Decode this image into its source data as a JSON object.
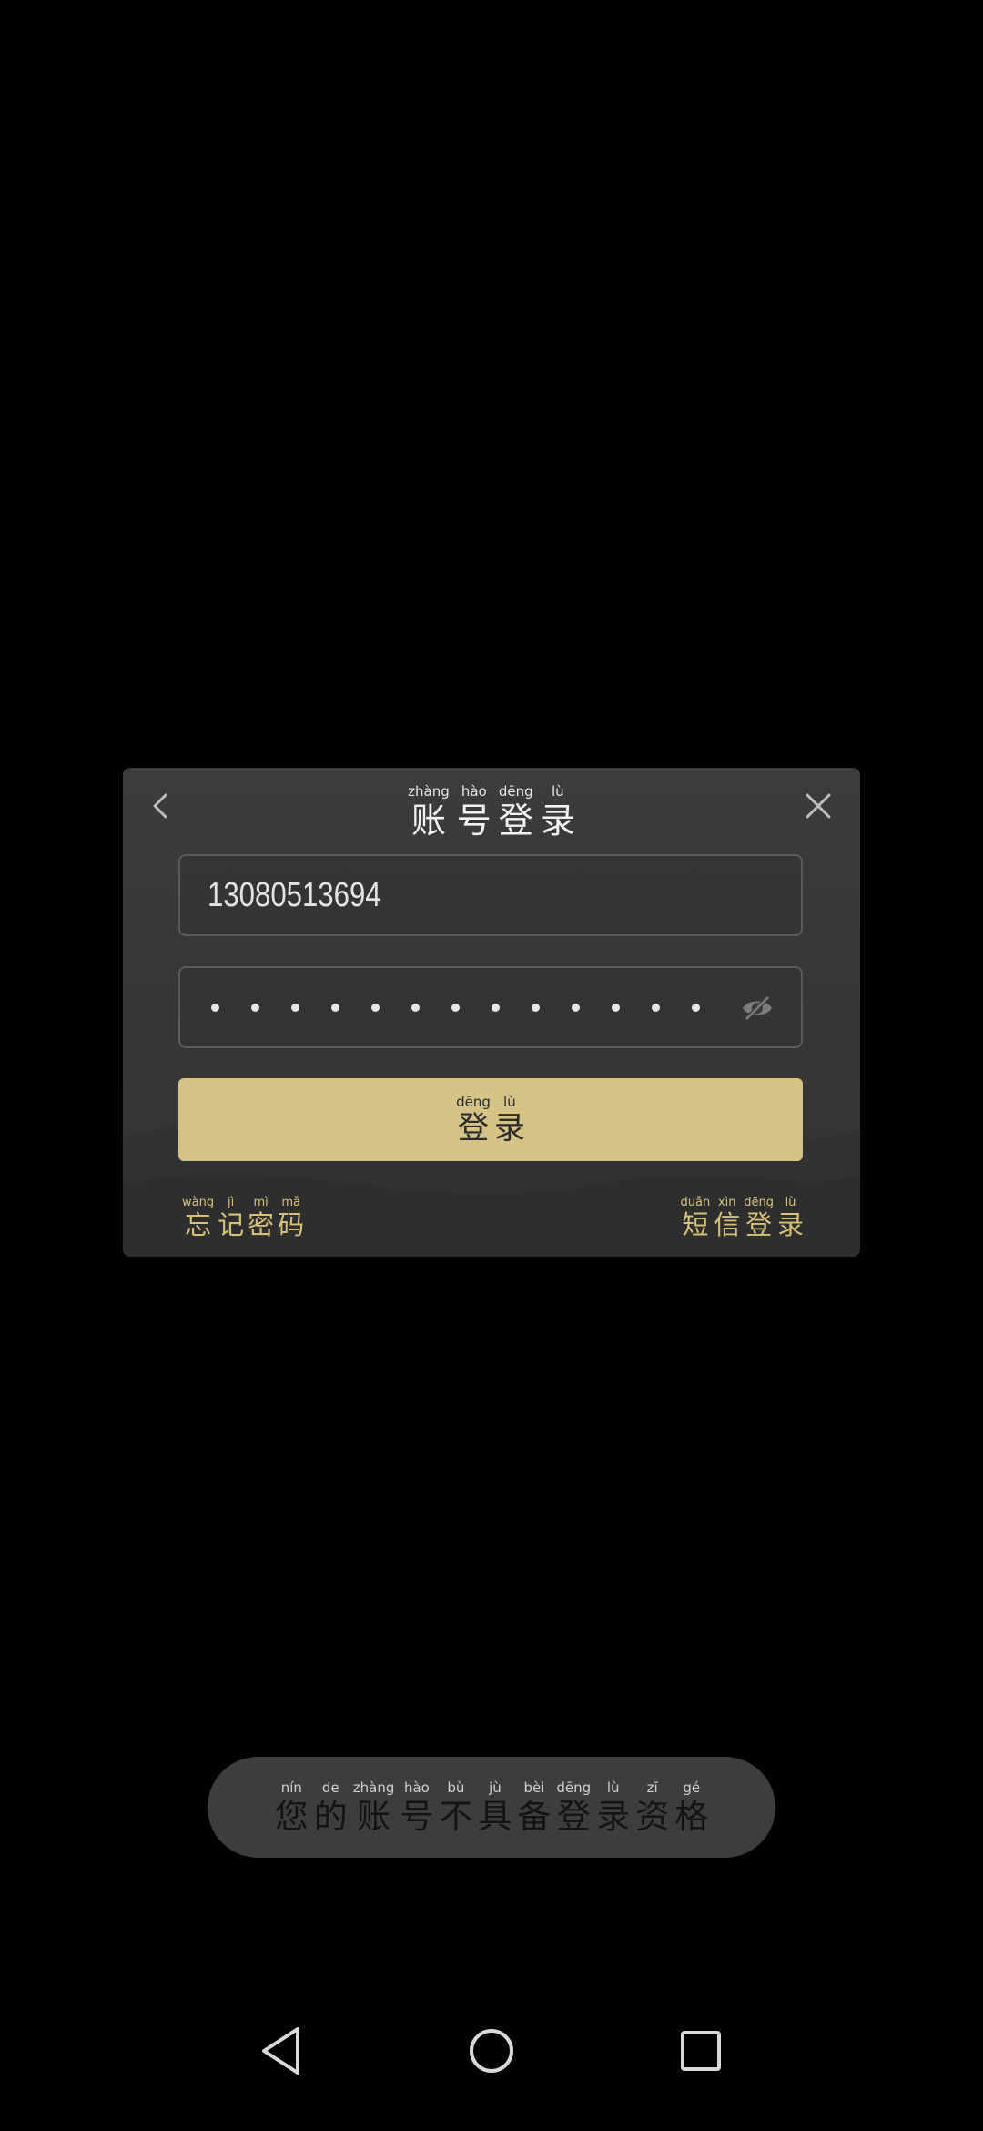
{
  "dialog": {
    "title": [
      {
        "py": "zhàng",
        "hz": "账"
      },
      {
        "py": "hào",
        "hz": "号"
      },
      {
        "py": "dēng",
        "hz": "登"
      },
      {
        "py": "lù",
        "hz": "录"
      }
    ],
    "back_icon": "chevron-left-icon",
    "close_icon": "close-icon",
    "phone_value": "13080513694",
    "password_dot_count": 13,
    "eye_icon": "eye-off-icon",
    "login_button": [
      {
        "py": "dēng",
        "hz": "登"
      },
      {
        "py": "lù",
        "hz": "录"
      }
    ],
    "forgot_password": [
      {
        "py": "wàng",
        "hz": "忘"
      },
      {
        "py": "jì",
        "hz": "记"
      },
      {
        "py": "mì",
        "hz": "密"
      },
      {
        "py": "mǎ",
        "hz": "码"
      }
    ],
    "sms_login": [
      {
        "py": "duǎn",
        "hz": "短"
      },
      {
        "py": "xìn",
        "hz": "信"
      },
      {
        "py": "dēng",
        "hz": "登"
      },
      {
        "py": "lù",
        "hz": "录"
      }
    ]
  },
  "toast": [
    {
      "py": "nín",
      "hz": "您"
    },
    {
      "py": "de",
      "hz": "的"
    },
    {
      "py": "zhàng",
      "hz": "账"
    },
    {
      "py": "hào",
      "hz": "号"
    },
    {
      "py": "bù",
      "hz": "不"
    },
    {
      "py": "jù",
      "hz": "具"
    },
    {
      "py": "bèi",
      "hz": "备"
    },
    {
      "py": "dēng",
      "hz": "登"
    },
    {
      "py": "lù",
      "hz": "录"
    },
    {
      "py": "zī",
      "hz": "资"
    },
    {
      "py": "gé",
      "hz": "格"
    }
  ],
  "navbar": {
    "back_icon": "triangle-back-icon",
    "home_icon": "circle-home-icon",
    "recent_icon": "square-recents-icon"
  },
  "colors": {
    "accent_gold": "#d5c285",
    "link_gold": "#d6c07a",
    "dialog_bg": "#3a3a3a",
    "toast_bg": "#3d3d3d"
  }
}
